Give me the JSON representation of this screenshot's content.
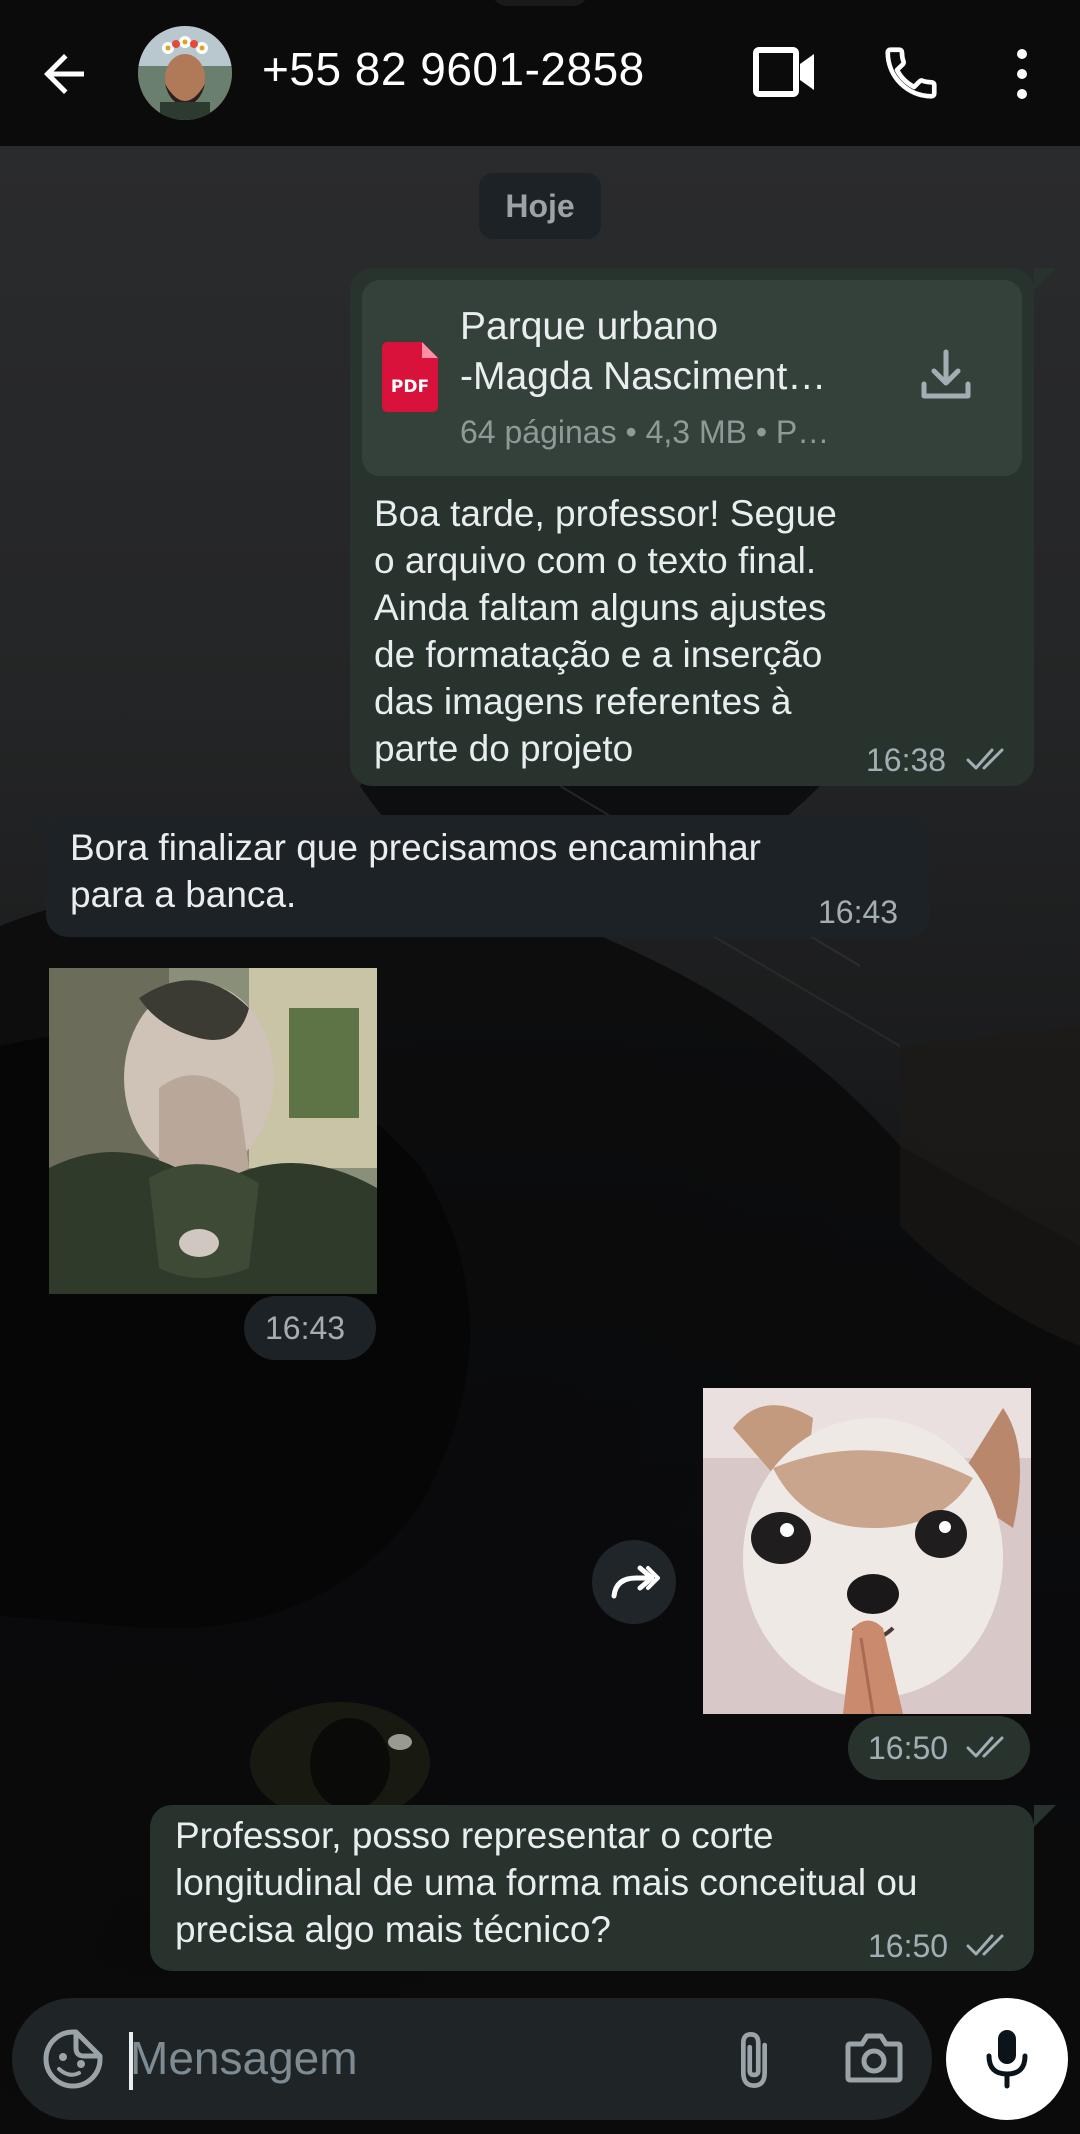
{
  "header": {
    "contact_name": "+55 82 9601-2858",
    "icons": [
      "arrow-back-icon",
      "contact-avatar",
      "videocam-icon",
      "phone-icon",
      "more-vert-icon"
    ]
  },
  "chat": {
    "date_chip": "Hoje",
    "messages": [
      {
        "direction": "outgoing",
        "type": "document",
        "document": {
          "title_line1": "Parque urbano",
          "title_line2": "-Magda Nasciment…",
          "meta": "64 páginas • 4,3 MB • P…",
          "file_type": "PDF"
        },
        "text_lines": [
          "Boa tarde, professor! Segue",
          "o arquivo com o texto final.",
          "Ainda faltam alguns ajustes",
          "de formatação e a inserção",
          "das imagens referentes à",
          "parte do projeto"
        ],
        "time": "16:38",
        "status": "read"
      },
      {
        "direction": "incoming",
        "type": "text",
        "text_lines": [
          "Bora finalizar que precisamos encaminhar",
          "para a banca."
        ],
        "time": "16:43"
      },
      {
        "direction": "incoming",
        "type": "sticker",
        "time": "16:43"
      },
      {
        "direction": "outgoing",
        "type": "sticker",
        "time": "16:50",
        "status": "read"
      },
      {
        "direction": "outgoing",
        "type": "text",
        "text_lines": [
          "Professor, posso representar o corte",
          "longitudinal de uma forma mais conceitual ou",
          "precisa algo mais técnico?"
        ],
        "time": "16:50",
        "status": "read"
      }
    ]
  },
  "composer": {
    "placeholder": "Mensagem",
    "value": "",
    "icons": [
      "emoji-sticker-icon",
      "attach-icon",
      "camera-icon",
      "mic-icon"
    ]
  },
  "colors": {
    "header_bg": "#0b0b0b",
    "outgoing_bubble": "#27332c",
    "incoming_bubble": "#1d2226",
    "document_card": "#34413a",
    "pdf_red": "#d8123a",
    "tick_gray": "#a3aeb4",
    "text": "#e9edef"
  }
}
